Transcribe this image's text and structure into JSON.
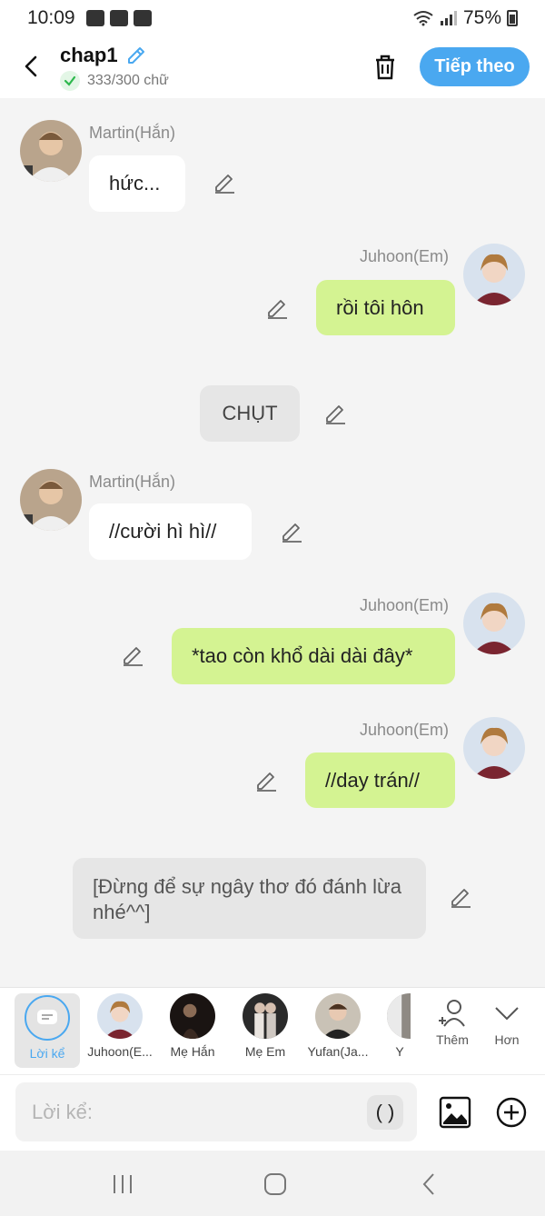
{
  "status": {
    "time": "10:09",
    "battery": "75%"
  },
  "header": {
    "title": "chap1",
    "word_count": "333/300 chữ",
    "next_label": "Tiếp theo"
  },
  "messages": [
    {
      "name": "Martin(Hắn)",
      "text": "hức..."
    },
    {
      "name": "Juhoon(Em)",
      "text": "rồi tôi hôn"
    },
    {
      "text": "CHỤT"
    },
    {
      "name": "Martin(Hắn)",
      "text": "//cười hì hì//"
    },
    {
      "name": "Juhoon(Em)",
      "text": "*tao còn khổ dài dài đây*"
    },
    {
      "name": "Juhoon(Em)",
      "text": "//day trán//"
    },
    {
      "text": "[Đừng để sự ngây thơ đó đánh lừa nhé^^]"
    }
  ],
  "characters": [
    {
      "label": "Lời kể"
    },
    {
      "label": "Juhoon(E..."
    },
    {
      "label": "Mẹ Hắn"
    },
    {
      "label": "Mẹ Em"
    },
    {
      "label": "Yufan(Ja..."
    },
    {
      "label": "Y"
    }
  ],
  "tools": {
    "add_label": "Thêm",
    "more_label": "Hơn"
  },
  "input": {
    "placeholder": "Lời kể:",
    "paren_label": "( )"
  },
  "colors": {
    "accent": "#4aa8f0",
    "right_bubble": "#d4f392",
    "check": "#2db84d"
  }
}
